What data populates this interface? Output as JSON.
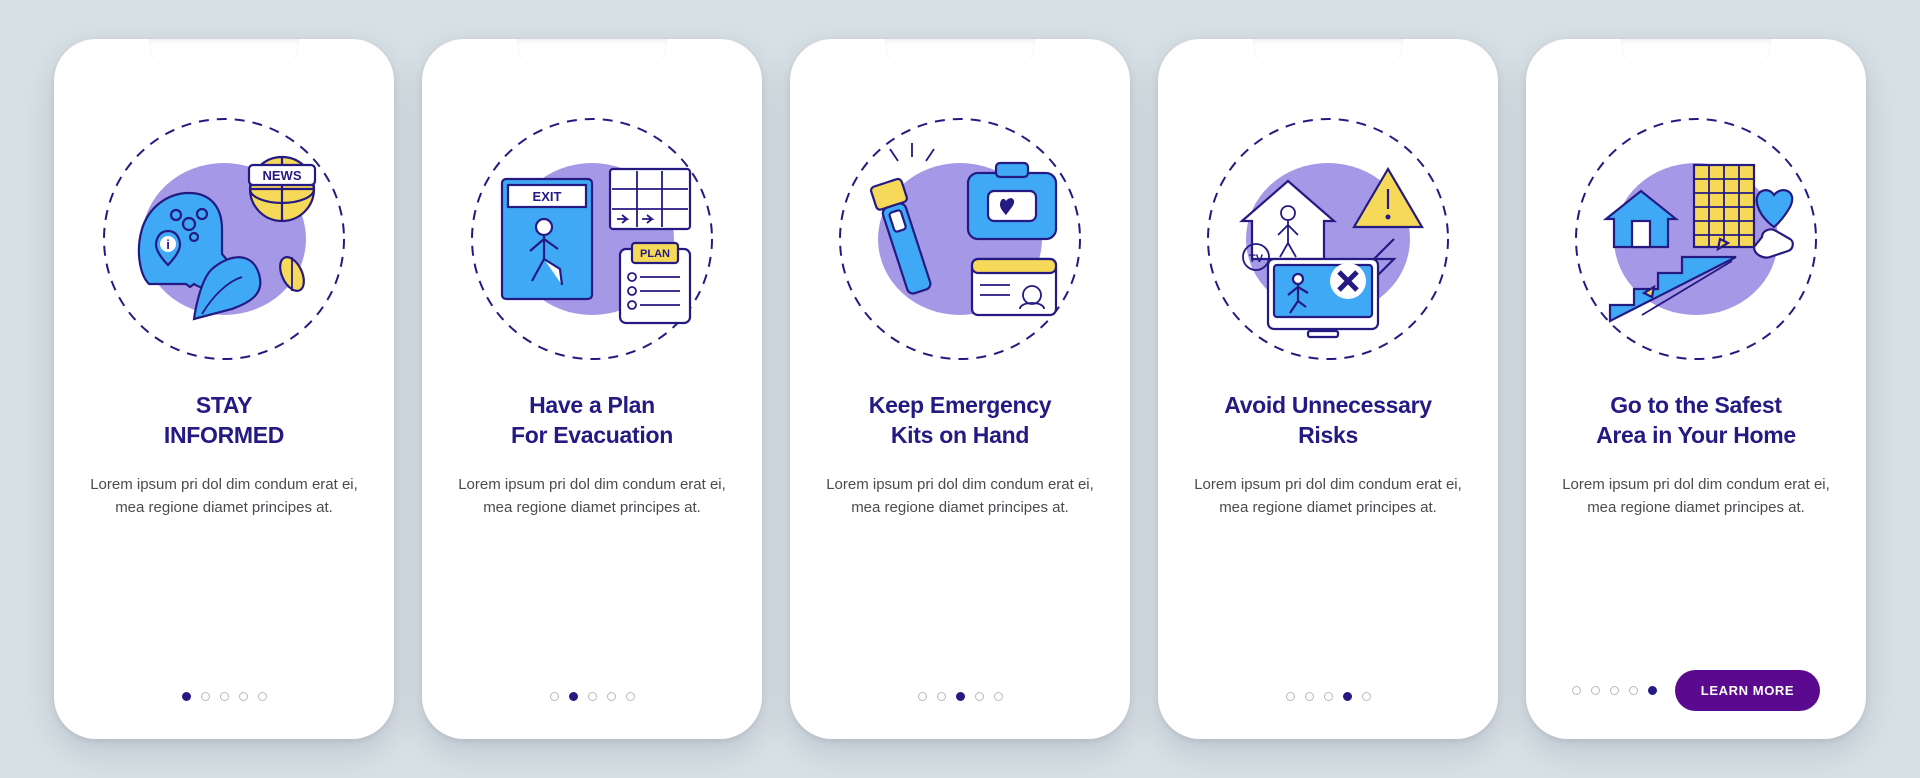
{
  "cards": [
    {
      "title_line1": "STAY",
      "title_line2": "INFORMED",
      "desc": "Lorem ipsum pri dol dim condum erat ei, mea regione diamet principes at.",
      "icon": "news-head-wave-icon",
      "active_dot": 0
    },
    {
      "title_line1": "Have a Plan",
      "title_line2": "For Evacuation",
      "desc": "Lorem ipsum pri dol dim condum erat ei, mea regione diamet principes at.",
      "icon": "exit-plan-icon",
      "active_dot": 1
    },
    {
      "title_line1": "Keep Emergency",
      "title_line2": "Kits on Hand",
      "desc": "Lorem ipsum pri dol dim condum erat ei, mea regione diamet principes at.",
      "icon": "emergency-kit-icon",
      "active_dot": 2
    },
    {
      "title_line1": "Avoid Unnecessary",
      "title_line2": "Risks",
      "desc": "Lorem ipsum pri dol dim condum erat ei, mea regione diamet principes at.",
      "icon": "avoid-risk-icon",
      "active_dot": 3
    },
    {
      "title_line1": "Go to the Safest",
      "title_line2": "Area in Your Home",
      "desc": "Lorem ipsum pri dol dim condum erat ei, mea regione diamet principes at.",
      "icon": "safe-area-icon",
      "active_dot": 4
    }
  ],
  "dot_count": 5,
  "cta_label": "LEARN MORE",
  "illustration_labels": {
    "news": "NEWS",
    "exit": "EXIT",
    "plan": "PLAN",
    "tv": "TV"
  },
  "colors": {
    "brand_dark": "#241a82",
    "brand_purple": "#5b0a8f",
    "illus_lavender": "#a498e7",
    "illus_blue": "#3fa9f5",
    "illus_yellow": "#f7d95a",
    "page_bg": "#d7e0e4"
  }
}
